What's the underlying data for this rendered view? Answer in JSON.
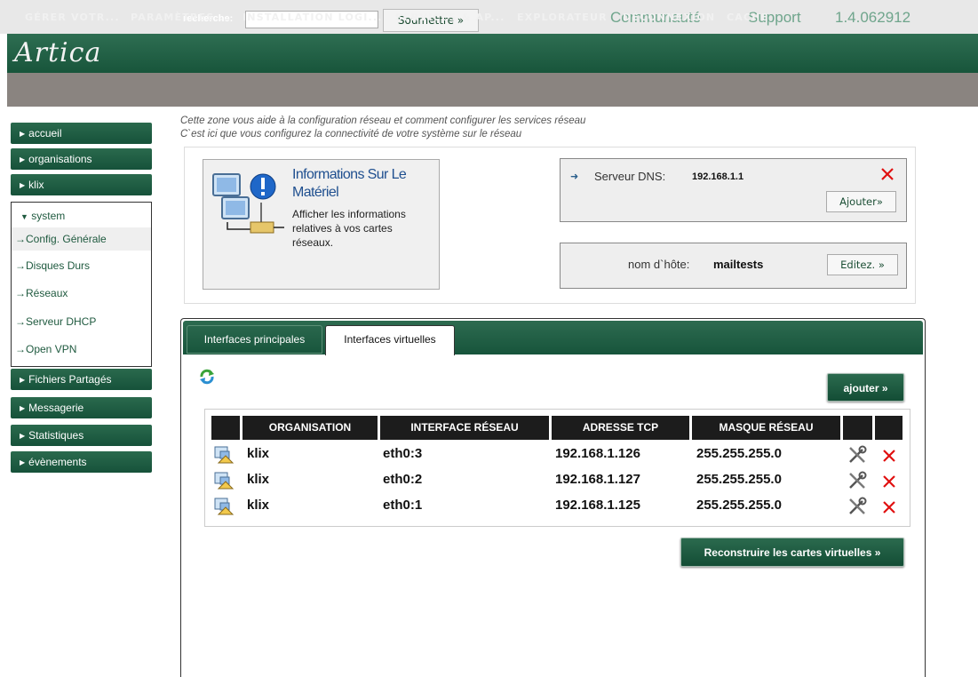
{
  "header": {
    "logo": "Artica",
    "search_label": "recherche:",
    "search_value": "",
    "submit_label": "Soumettre »",
    "community": "Communauté",
    "support": "Support",
    "version": "1.4.062912"
  },
  "menu": [
    "GÉRER VOTR...",
    "PARAMÈTRES...",
    "INSTALLATION LOGI...",
    "SERVICES & AP...",
    "EXPLORATEUR",
    "DÉCONNEXION",
    "CACHE"
  ],
  "sidebar": {
    "top_items": [
      "accueil",
      "organisations",
      "klix"
    ],
    "system_label": "system",
    "system_items": [
      "Config. Générale",
      "Disques Durs",
      "Réseaux",
      "Serveur DHCP",
      "Open VPN"
    ],
    "bottom_items": [
      "Fichiers Partagés",
      "Messagerie",
      "Statistiques",
      "évènements"
    ]
  },
  "intro": {
    "line1": "Cette zone vous aide à la configuration réseau et comment configurer les services réseau",
    "line2": "C`est ici que vous configurez la connectivité de votre système sur le réseau"
  },
  "hardware": {
    "title": "Informations Sur Le Matériel",
    "description": "Afficher les informations relatives à vos cartes réseaux."
  },
  "dns": {
    "label": "Serveur DNS:",
    "value": "192.168.1.1",
    "add_label": "Ajouter»"
  },
  "hostname": {
    "label": "nom d`hôte:",
    "value": "mailtests",
    "edit_label": "Editez. »"
  },
  "tabs": {
    "main": "Interfaces principales",
    "virtual": "Interfaces virtuelles"
  },
  "add_label": "ajouter »",
  "table": {
    "headers": [
      "ORGANISATION",
      "INTERFACE RÉSEAU",
      "ADRESSE TCP",
      "MASQUE RÉSEAU"
    ],
    "rows": [
      {
        "org": "klix",
        "iface": "eth0:3",
        "ip": "192.168.1.126",
        "mask": "255.255.255.0"
      },
      {
        "org": "klix",
        "iface": "eth0:2",
        "ip": "192.168.1.127",
        "mask": "255.255.255.0"
      },
      {
        "org": "klix",
        "iface": "eth0:1",
        "ip": "192.168.1.125",
        "mask": "255.255.255.0"
      }
    ]
  },
  "rebuild_label": "Reconstruire les cartes virtuelles  »",
  "colors": {
    "brand_green": "#18553b",
    "menu_gray": "#8a8480",
    "delete_red": "#e01010"
  }
}
